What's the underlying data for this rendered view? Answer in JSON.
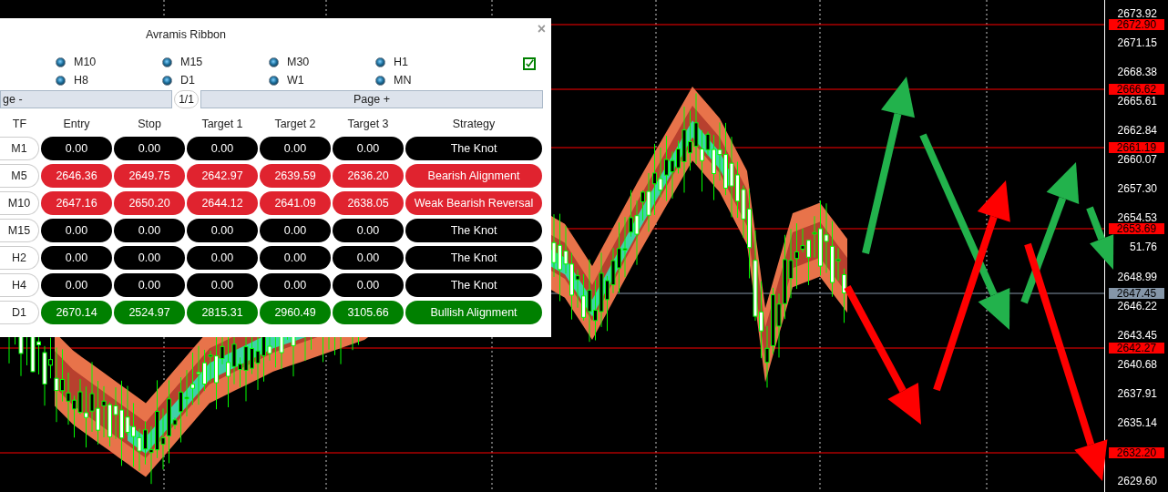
{
  "panel": {
    "title": "Avramis Ribbon",
    "close": "×",
    "enabled": {
      "checked": true
    },
    "timeframes": [
      {
        "label": "M10",
        "checked": true
      },
      {
        "label": "M15",
        "checked": true
      },
      {
        "label": "M30",
        "checked": true
      },
      {
        "label": "H1",
        "checked": true
      },
      {
        "label": "H8",
        "checked": true
      },
      {
        "label": "D1",
        "checked": true
      },
      {
        "label": "W1",
        "checked": true
      },
      {
        "label": "MN",
        "checked": true
      }
    ],
    "pager": {
      "previous": "ge -",
      "page": "1/1",
      "next": "Page +"
    },
    "table": {
      "columns": [
        "TF",
        "Entry",
        "Stop",
        "Target 1",
        "Target 2",
        "Target 3",
        "Strategy"
      ],
      "rows": [
        {
          "tf": "M1",
          "values": [
            "0.00",
            "0.00",
            "0.00",
            "0.00",
            "0.00"
          ],
          "strategy": "The Knot",
          "color": "#000000"
        },
        {
          "tf": "M5",
          "values": [
            "2646.36",
            "2649.75",
            "2642.97",
            "2639.59",
            "2636.20"
          ],
          "strategy": "Bearish Alignment",
          "color": "#e0232f"
        },
        {
          "tf": "M10",
          "values": [
            "2647.16",
            "2650.20",
            "2644.12",
            "2641.09",
            "2638.05"
          ],
          "strategy": "Weak Bearish Reversal",
          "color": "#e0232f"
        },
        {
          "tf": "M15",
          "values": [
            "0.00",
            "0.00",
            "0.00",
            "0.00",
            "0.00"
          ],
          "strategy": "The Knot",
          "color": "#000000"
        },
        {
          "tf": "H2",
          "values": [
            "0.00",
            "0.00",
            "0.00",
            "0.00",
            "0.00"
          ],
          "strategy": "The Knot",
          "color": "#000000"
        },
        {
          "tf": "H4",
          "values": [
            "0.00",
            "0.00",
            "0.00",
            "0.00",
            "0.00"
          ],
          "strategy": "The Knot",
          "color": "#000000"
        },
        {
          "tf": "D1",
          "values": [
            "2670.14",
            "2524.97",
            "2815.31",
            "2960.49",
            "3105.66"
          ],
          "strategy": "Bullish Alignment",
          "color": "#008000"
        }
      ]
    }
  },
  "price_axis": {
    "ticks": [
      "2673.92",
      "2671.15",
      "2668.38",
      "2665.61",
      "2662.84",
      "2660.07",
      "2657.30",
      "2654.53",
      "51.76",
      "2648.99",
      "2646.22",
      "2643.45",
      "2640.68",
      "2637.91",
      "2635.14",
      "2629.60"
    ],
    "tags": [
      {
        "price": "2672.90",
        "color": "#ff0000"
      },
      {
        "price": "2666.62",
        "color": "#ff0000"
      },
      {
        "price": "2661.19",
        "color": "#ff0000"
      },
      {
        "price": "2653.69",
        "color": "#ff0000"
      },
      {
        "price": "2647.45",
        "color": "#8596a8"
      },
      {
        "price": "2642.27",
        "color": "#ff0000"
      },
      {
        "price": "2632.20",
        "color": "#ff0000"
      }
    ]
  }
}
